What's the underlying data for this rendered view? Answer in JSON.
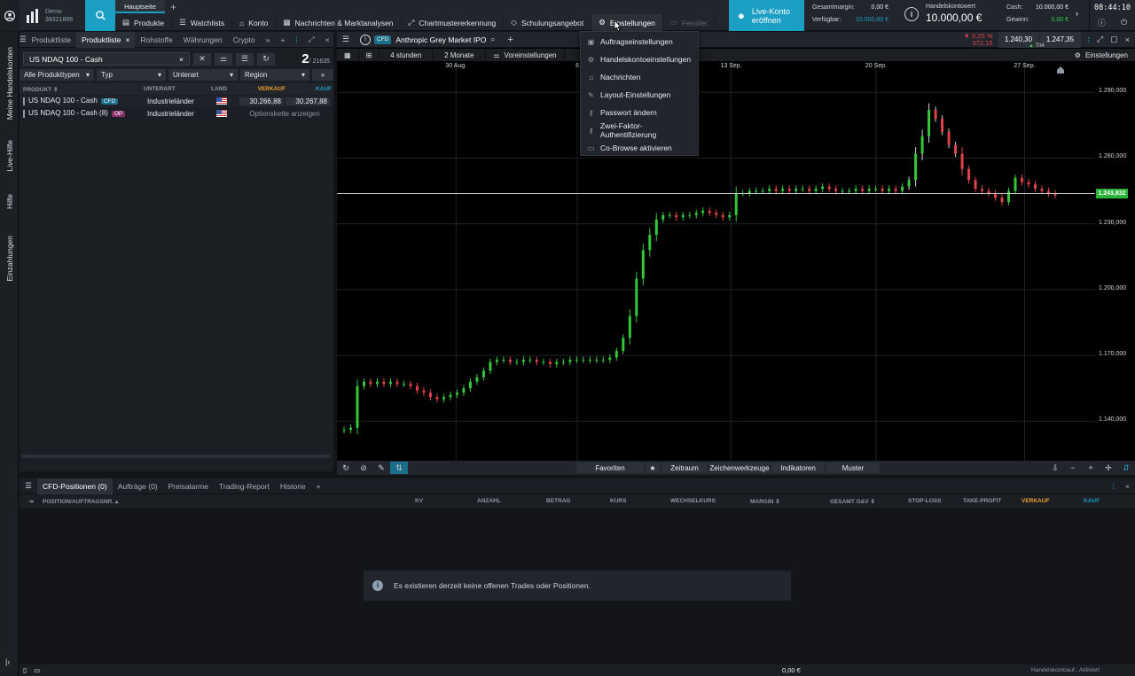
{
  "app": {
    "demo_label": "Demo",
    "account_id": "39321866",
    "tab_main": "Hauptseite",
    "clock": "08:44:10"
  },
  "menu": [
    "Produkte",
    "Watchlists",
    "Konto",
    "Nachrichten & Marktanalysen",
    "Chartmustererkennung",
    "Schulungsangebot",
    "Einstellungen",
    "Fenster"
  ],
  "live": {
    "line1": "Live-Konto",
    "line2": "eröffnen"
  },
  "stats": {
    "margin_label": "Gesamtmargin:",
    "margin_value": "0,00 €",
    "avail_label": "Verfügbar:",
    "avail_value": "10.000,00 €",
    "kontowert_label": "Handelskontowert",
    "kontowert_value": "10.000,00 €",
    "cash_label": "Cash:",
    "cash_value": "10.000,00 €",
    "gewinn_label": "Gewinn:",
    "gewinn_value": "0,00 €"
  },
  "rail": [
    "Meine Handelskonten",
    "Live-Hilfe",
    "Hilfe",
    "Einzahlungen"
  ],
  "products": {
    "tabs": [
      "Produktliste",
      "Produktliste",
      "Rohstoffe",
      "Währungen",
      "Crypto"
    ],
    "search": "US NDAQ 100 - Cash",
    "count": "2",
    "total": "/ 21635",
    "filters": [
      "Alle Produkttypen",
      "Typ",
      "Unterart",
      "Region"
    ],
    "headers": {
      "produkt": "PRODUKT",
      "unterart": "UNTERART",
      "land": "LAND",
      "verkauf": "VERKAUF",
      "kauf": "KAUF"
    },
    "rows": [
      {
        "name": "US NDAQ 100 - Cash",
        "badge": "CFD",
        "unterart": "Industrieländer",
        "sell": "30.266,88",
        "buy": "30.267,88"
      },
      {
        "name": "US NDAQ 100 - Cash (8)",
        "badge": "OP",
        "unterart": "Industrieländer",
        "chain": "Optionskette anzeigen"
      }
    ]
  },
  "chart": {
    "badge": "CFD",
    "title": "Anthropic Grey Market IPO",
    "change_pct": "▼ 0,25 %",
    "change_abs": "372,15",
    "bid": "1.240,30",
    "ask": "1.247,35",
    "spread": "704",
    "toolbar": [
      "4 stunden",
      "2 Monate",
      "Voreinstellungen"
    ],
    "settings": "Einstellungen",
    "bottom": [
      "Favoriten",
      "Zeitraum",
      "Zeichenwerkzeuge",
      "Indikatoren",
      "Muster"
    ]
  },
  "chart_data": {
    "type": "candlestick",
    "x_ticks": [
      "30 Aug.",
      "6",
      "13 Sep.",
      "20 Sep.",
      "27 Sep."
    ],
    "y_ticks": [
      "1.290,000",
      "1.260,000",
      "1.230,000",
      "1.200,000",
      "1.170,000",
      "1.140,000"
    ],
    "ylim": [
      1126,
      1301
    ],
    "current_price_label": "1.243,832",
    "current_price": 1243.83,
    "close_values": [
      1136,
      1137,
      1156,
      1158,
      1157,
      1158,
      1157,
      1158,
      1157,
      1157,
      1156,
      1154,
      1153,
      1151,
      1150,
      1151,
      1152,
      1153,
      1155,
      1158,
      1160,
      1163,
      1167,
      1168,
      1168,
      1167,
      1167,
      1168,
      1168,
      1167,
      1167,
      1166,
      1167,
      1167,
      1168,
      1168,
      1168,
      1168,
      1168,
      1168,
      1169,
      1172,
      1178,
      1188,
      1205,
      1218,
      1225,
      1232,
      1234,
      1234,
      1233,
      1234,
      1234,
      1235,
      1236,
      1235,
      1234,
      1233,
      1234,
      1244,
      1244,
      1245,
      1245,
      1245,
      1246,
      1245,
      1246,
      1245,
      1246,
      1246,
      1245,
      1246,
      1247,
      1246,
      1245,
      1245,
      1245,
      1246,
      1245,
      1246,
      1246,
      1245,
      1246,
      1245,
      1247,
      1250,
      1262,
      1270,
      1282,
      1278,
      1272,
      1266,
      1262,
      1255,
      1250,
      1246,
      1245,
      1244,
      1242,
      1240,
      1245,
      1251,
      1249,
      1248,
      1246,
      1245,
      1244,
      1243
    ]
  },
  "dropdown": [
    "Auftragseinstellungen",
    "Handelskontoeinstellungen",
    "Nachrichten",
    "Layout-Einstellungen",
    "Passwort ändern",
    "Zwei-Faktor-Authentifizierung",
    "Co-Browse aktivieren"
  ],
  "positions": {
    "tabs": [
      "CFD-Positionen (0)",
      "Aufträge (0)",
      "Preisalarme",
      "Trading-Report",
      "Historie"
    ],
    "headers": [
      "POSITION/AUFTRAGSNR.",
      "KV",
      "ANZAHL",
      "BETRAG",
      "KURS",
      "WECHSELKURS",
      "MARGIN",
      "GESAMT G&V",
      "STOP-LOSS",
      "TAKE-PROFIT",
      "VERKAUF",
      "KAUF"
    ],
    "empty": "Es existieren derzeit keine offenen Trades oder Positionen."
  },
  "status": {
    "total": "0,00 €",
    "mode": "Handelskontoauf.: Aktiviert"
  }
}
